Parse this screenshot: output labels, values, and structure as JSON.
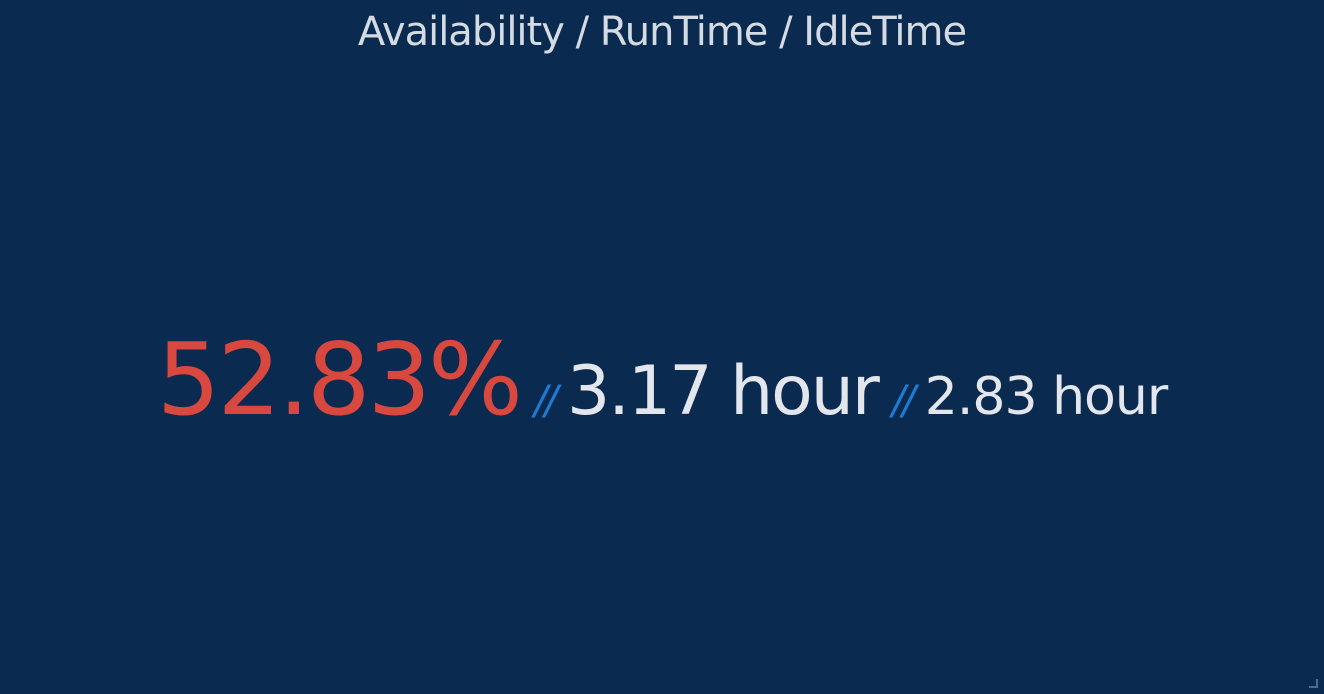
{
  "panel": {
    "title": "Availability / RunTime / IdleTime"
  },
  "stats": {
    "availability": "52.83%",
    "separator": "//",
    "run_time": "3.17 hour",
    "idle_time": "2.83 hour"
  },
  "colors": {
    "background": "#0a2a4f",
    "title": "#d5dbe3",
    "availability": "#d8483f",
    "separator": "#1e7bd4",
    "value": "#e3e7ed"
  },
  "icons": {
    "resize_handle": "resize-handle-icon"
  }
}
